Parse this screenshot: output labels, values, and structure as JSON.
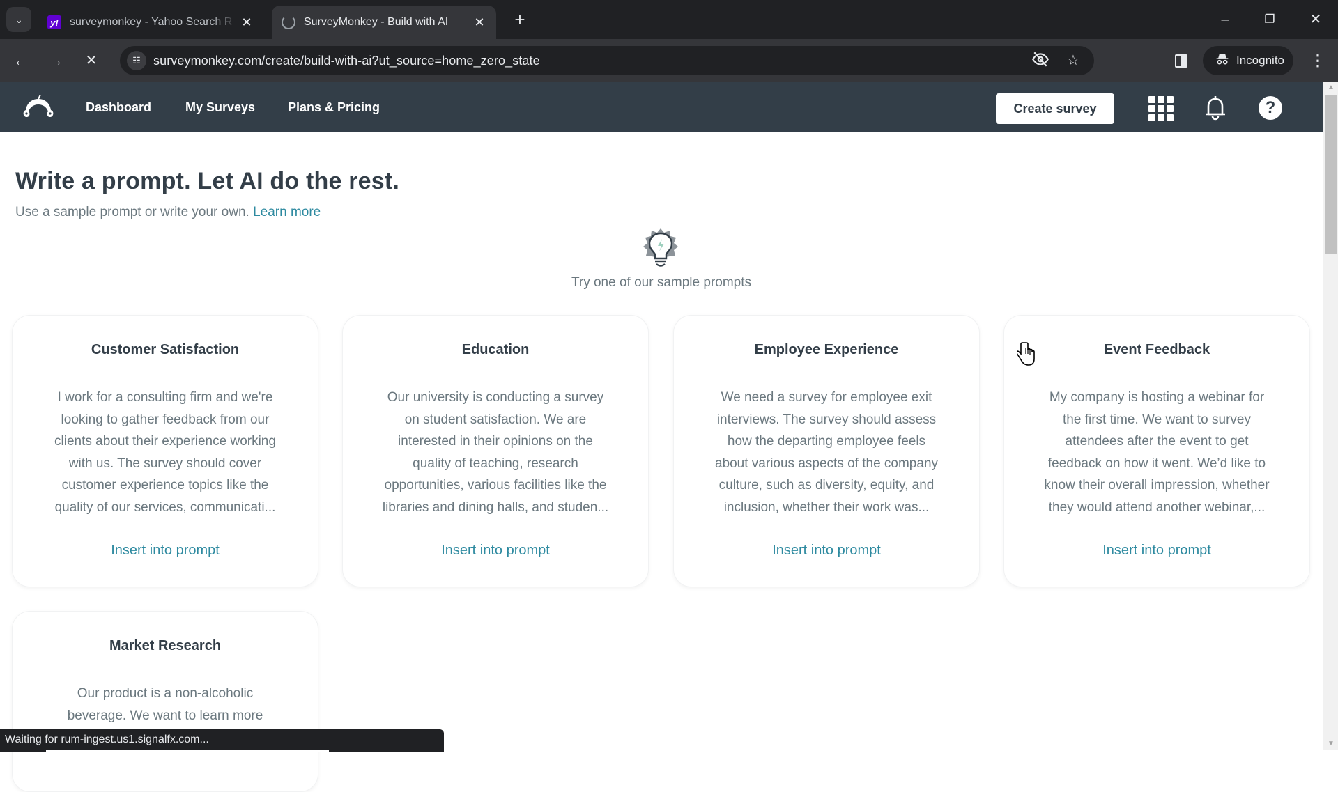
{
  "browser": {
    "tabs": [
      {
        "title": "surveymonkey - Yahoo Search R",
        "favicon": "yahoo-icon",
        "active": false
      },
      {
        "title": "SurveyMonkey - Build with AI",
        "favicon": "loading-spinner-icon",
        "active": true
      }
    ],
    "tab_search_icon": "⌄",
    "close_glyph": "✕",
    "new_tab_glyph": "+",
    "window_controls": {
      "minimize": "–",
      "restore": "❐",
      "close": "✕"
    },
    "nav": {
      "back": "←",
      "forward": "→",
      "stop": "✕"
    },
    "url": "surveymonkey.com/create/build-with-ai?ut_source=home_zero_state",
    "incognito_label": "Incognito",
    "menu_glyph": "⋮",
    "status_text": "Waiting for rum-ingest.us1.signalfx.com..."
  },
  "site_nav": {
    "links": [
      "Dashboard",
      "My Surveys",
      "Plans & Pricing"
    ],
    "create_button": "Create survey",
    "help_glyph": "?"
  },
  "page": {
    "title": "Write a prompt. Let AI do the rest.",
    "subtitle": "Use a sample prompt or write your own.",
    "learn_more": "Learn more",
    "samples_heading": "Try one of our sample prompts"
  },
  "cards": [
    {
      "title": "Customer Satisfaction",
      "lines": [
        "I work for a consulting firm and we're",
        "looking to gather feedback from our",
        "clients about their experience working",
        "with us. The survey should cover",
        "customer experience topics like the",
        "quality of our services, communicati..."
      ],
      "link": "Insert into prompt"
    },
    {
      "title": "Education",
      "lines": [
        "Our university is conducting a survey",
        "on student satisfaction. We are",
        "interested in their opinions on the",
        "quality of teaching, research",
        "opportunities, various facilities like the",
        "libraries and dining halls, and studen..."
      ],
      "link": "Insert into prompt"
    },
    {
      "title": "Employee Experience",
      "lines": [
        "We need a survey for employee exit",
        "interviews. The survey should assess",
        "how the departing employee feels",
        "about various aspects of the company",
        "culture, such as diversity, equity, and",
        "inclusion, whether their work was..."
      ],
      "link": "Insert into prompt"
    },
    {
      "title": "Event Feedback",
      "lines": [
        "My company is hosting a webinar for",
        "the first time. We want to survey",
        "attendees after the event to get",
        "feedback on how it went. We’d like to",
        "know their overall impression, whether",
        "they would attend another webinar,..."
      ],
      "link": "Insert into prompt"
    },
    {
      "title": "Market Research",
      "lines": [
        "Our product is a non-alcoholic",
        "beverage. We want to learn more"
      ],
      "link": ""
    }
  ],
  "colors": {
    "nav_bg": "#333e48",
    "link": "#2e8aa0",
    "heading": "#333e48",
    "body_text": "#6b787f"
  }
}
